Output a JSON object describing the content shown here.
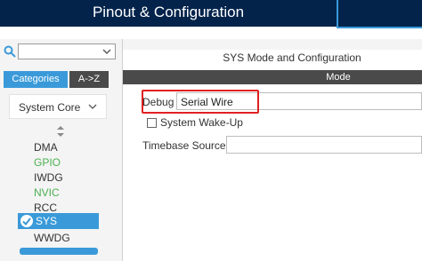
{
  "header": {
    "title": "Pinout & Configuration"
  },
  "sidebar": {
    "search": {
      "value": "",
      "placeholder": ""
    },
    "tabs": [
      {
        "label": "Categories",
        "active": true
      },
      {
        "label": "A->Z",
        "active": false
      }
    ],
    "group": {
      "label": "System Core"
    },
    "items": [
      {
        "label": "DMA",
        "color": "#333333"
      },
      {
        "label": "GPIO",
        "color": "#4caf50"
      },
      {
        "label": "IWDG",
        "color": "#333333"
      },
      {
        "label": "NVIC",
        "color": "#4caf50"
      },
      {
        "label": "RCC",
        "color": "#333333"
      },
      {
        "label": "SYS",
        "color": "#ffffff",
        "selected": true
      },
      {
        "label": "WWDG",
        "color": "#333333"
      }
    ]
  },
  "main": {
    "title": "SYS Mode and Configuration",
    "mode_header": "Mode",
    "debug": {
      "label": "Debug",
      "value": "Serial Wire"
    },
    "wakeup": {
      "label": "System Wake-Up",
      "checked": false
    },
    "timebase": {
      "label": "Timebase Source",
      "value": ""
    }
  },
  "colors": {
    "header_bg": "#03234b",
    "accent": "#3a9ad9",
    "highlight": "#e02020",
    "green_item": "#4caf50"
  }
}
